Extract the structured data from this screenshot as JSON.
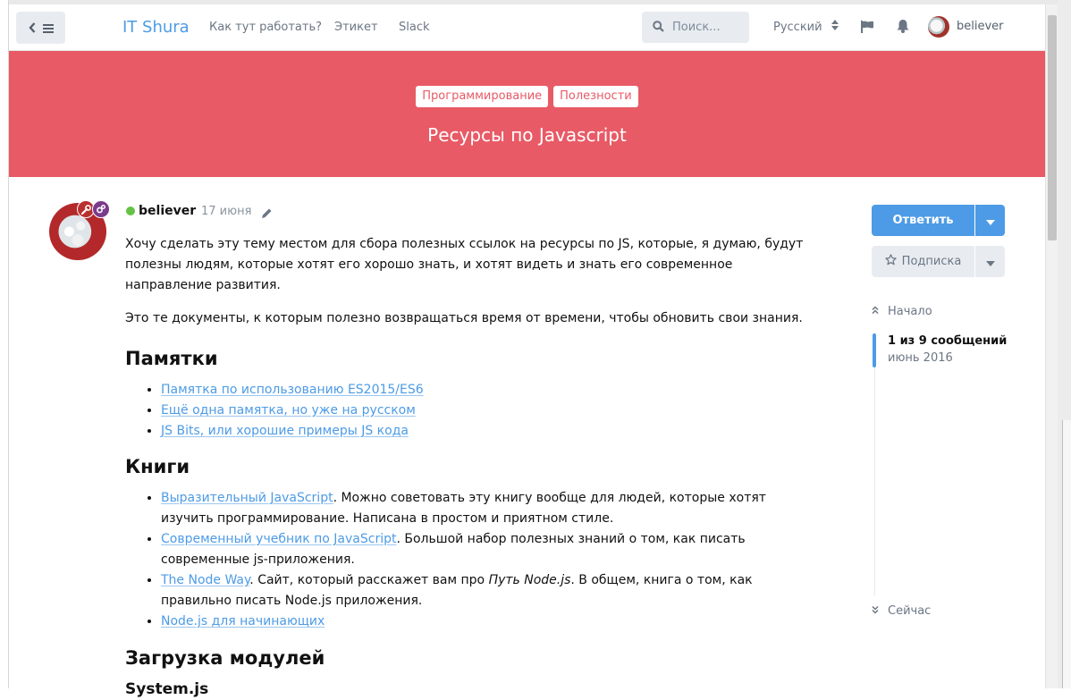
{
  "header": {
    "site_title": "IT Shura",
    "nav_links": [
      "Как тут работать?",
      "Этикет",
      "Slack"
    ],
    "search_placeholder": "Поиск...",
    "language": "Русский",
    "username": "believer"
  },
  "hero": {
    "tags": [
      "Программирование",
      "Полезности"
    ],
    "title": "Ресурсы по Javascript",
    "background_color": "#e85a66"
  },
  "post": {
    "author": "believer",
    "date": "17 июня",
    "intro_1": "Хочу сделать эту тему местом для сбора полезных ссылок на ресурсы по JS, которые, я думаю, будут полезны людям, которые хотят его хорошо знать, и хотят видеть и знать его современное направление развития.",
    "intro_2": "Это те документы, к которым полезно возвращаться время от времени, чтобы обновить свои знания.",
    "section_cheats": "Памятки",
    "cheat_links": [
      "Памятка по использованию ES2015/ES6",
      "Ещё одна памятка, но уже на русском",
      "JS Bits, или хорошие примеры JS кода"
    ],
    "section_books": "Книги",
    "books": [
      {
        "link": "Выразительный JavaScript",
        "text": ". Можно советовать эту книгу вообще для людей, которые хотят изучить программирование. Написана в простом и приятном стиле."
      },
      {
        "link": "Современный учебник по JavaScript",
        "text": ". Большой набор полезных знаний о том, как писать современные js-приложения."
      },
      {
        "link": "The Node Way",
        "text_before_em": ". Сайт, который расскажет вам про ",
        "em": "Путь Node.js",
        "text_after_em": ". В общем, книга о том, как правильно писать Node.js приложения."
      },
      {
        "link": "Node.js для начинающих"
      }
    ],
    "section_modules": "Загрузка модулей",
    "subsection_systemjs": "System.js"
  },
  "sidebar": {
    "reply_label": "Ответить",
    "subscribe_label": "Подписка",
    "scrub_start": "Начало",
    "scrub_count": "1 из 9 сообщений",
    "scrub_date": "июнь 2016",
    "scrub_now": "Сейчас",
    "accent_color": "#4d9be6"
  },
  "icons": [
    "chevron-left-icon",
    "menu-icon",
    "search-icon",
    "sort-icon",
    "flag-icon",
    "bell-icon",
    "wrench-icon",
    "gears-icon",
    "pencil-icon",
    "caret-down-icon",
    "star-icon",
    "double-up-icon",
    "double-down-icon"
  ]
}
